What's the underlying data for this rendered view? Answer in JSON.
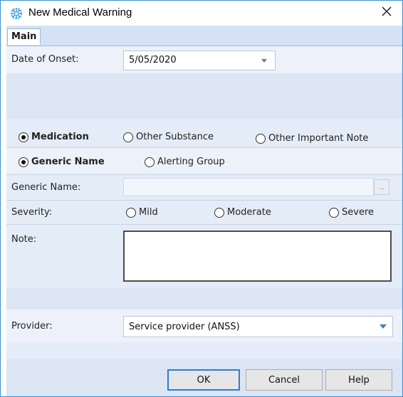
{
  "window": {
    "title": "New Medical Warning",
    "icon": "medical-star-icon",
    "close_icon": "close-icon"
  },
  "tabs": [
    {
      "label": "Main",
      "active": true
    }
  ],
  "form": {
    "date_of_onset": {
      "label": "Date of Onset:",
      "value": "5/05/2020"
    },
    "warning_type": {
      "options": [
        "Medication",
        "Other Substance",
        "Other Important Note"
      ],
      "selected": "Medication"
    },
    "name_type": {
      "options": [
        "Generic Name",
        "Alerting Group"
      ],
      "selected": "Generic Name"
    },
    "generic_name": {
      "label": "Generic Name:",
      "value": "",
      "lookup_label": ".."
    },
    "severity": {
      "label": "Severity:",
      "options": [
        "Mild",
        "Moderate",
        "Severe"
      ],
      "selected": ""
    },
    "note": {
      "label": "Note:",
      "value": ""
    },
    "provider": {
      "label": "Provider:",
      "value": "Service provider (ANSS)"
    }
  },
  "buttons": {
    "ok": "OK",
    "cancel": "Cancel",
    "help": "Help"
  },
  "colors": {
    "accent": "#2f7bd6",
    "tab_strip": "#d5e2f5",
    "content_bg": "#e4ecf7",
    "icon": "#3aa8d8"
  }
}
